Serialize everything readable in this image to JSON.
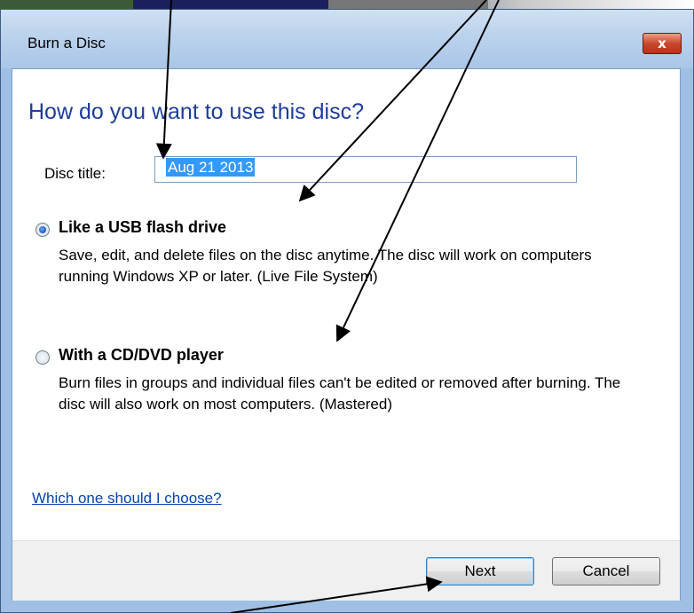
{
  "window": {
    "title": "Burn a Disc",
    "close_label": "x"
  },
  "dialog": {
    "heading": "How do you want to use this disc?",
    "disc_title_label": "Disc title:",
    "disc_title_value": "Aug 21 2013",
    "options": [
      {
        "title": "Like a USB flash drive",
        "description": "Save, edit, and delete files on the disc anytime. The disc will work on computers running Windows XP or later. (Live File System)",
        "selected": true
      },
      {
        "title": "With a CD/DVD player",
        "description": "Burn files in groups and individual files can't be edited or removed after burning. The disc will also work on most computers. (Mastered)",
        "selected": false
      }
    ],
    "help_link": "Which one should I choose?",
    "buttons": {
      "next": "Next",
      "cancel": "Cancel"
    }
  },
  "colors": {
    "heading": "#1e3d9a",
    "link": "#0645ad",
    "selection": "#3399ff",
    "close": "#c9482c"
  }
}
